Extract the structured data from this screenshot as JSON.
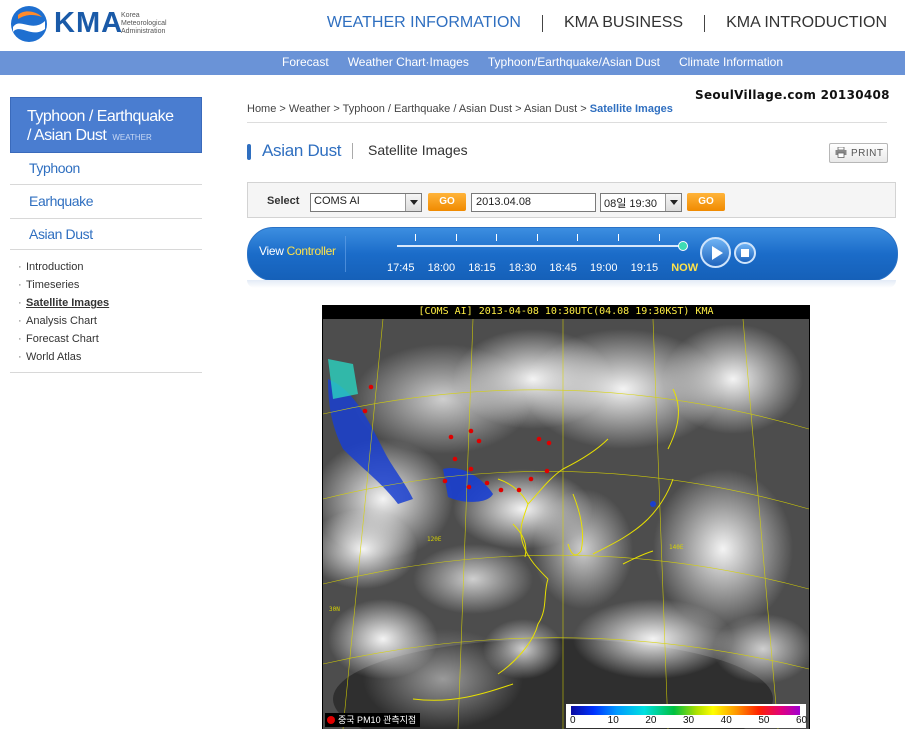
{
  "header": {
    "logo_text": "KMA",
    "logo_sub": "Korea Meteorological Administration",
    "nav": [
      "WEATHER INFORMATION",
      "KMA BUSINESS",
      "KMA INTRODUCTION"
    ]
  },
  "subnav": [
    "Forecast",
    "Weather Chart·Images",
    "Typhoon/Earthquake/Asian Dust",
    "Climate Information"
  ],
  "sidebar": {
    "heading": "Typhoon / Earthquake / Asian Dust",
    "heading_line1": "Typhoon / Earthquake",
    "heading_line2": "/ Asian Dust",
    "heading_tag": "WEATHER",
    "main_items": [
      "Typhoon",
      "Earhquake",
      "Asian Dust"
    ],
    "sub_items": [
      "Introduction",
      "Timeseries",
      "Satellite Images",
      "Analysis Chart",
      "Forecast Chart",
      "World Atlas"
    ],
    "active_sub": "Satellite Images"
  },
  "breadcrumb": {
    "items": [
      "Home",
      "Weather",
      "Typhoon / Earthquake / Asian Dust",
      "Asian Dust"
    ],
    "current": "Satellite Images",
    "separator": ">"
  },
  "watermark": "SeoulVillage.com 20130408",
  "page": {
    "title": "Asian Dust",
    "subtitle": "Satellite Images",
    "print_label": "PRINT"
  },
  "selector": {
    "label": "Select",
    "product": "COMS AI",
    "go1": "GO",
    "date": "2013.04.08",
    "time": "08일 19:30",
    "go2": "GO"
  },
  "controller": {
    "view": "View",
    "controller_word": "Controller",
    "times": [
      "17:45",
      "18:00",
      "18:15",
      "18:30",
      "18:45",
      "19:00",
      "19:15",
      "NOW"
    ],
    "position": 1.0
  },
  "satellite": {
    "title": "[COMS AI] 2013-04-08 10:30UTC(04.08 19:30KST) KMA",
    "point_legend": "중국 PM10 관측지점",
    "scale_labels": [
      "0",
      "10",
      "20",
      "30",
      "40",
      "50",
      "60"
    ],
    "latlon_labels": [
      "120E",
      "140E",
      "30N"
    ]
  },
  "colors": {
    "brand_blue": "#2f6fc0",
    "subnav_blue": "#6a93d7",
    "go_orange": "#f5a21c",
    "now_yellow": "#ffe24a",
    "sat_title_yellow": "#ffef45"
  }
}
